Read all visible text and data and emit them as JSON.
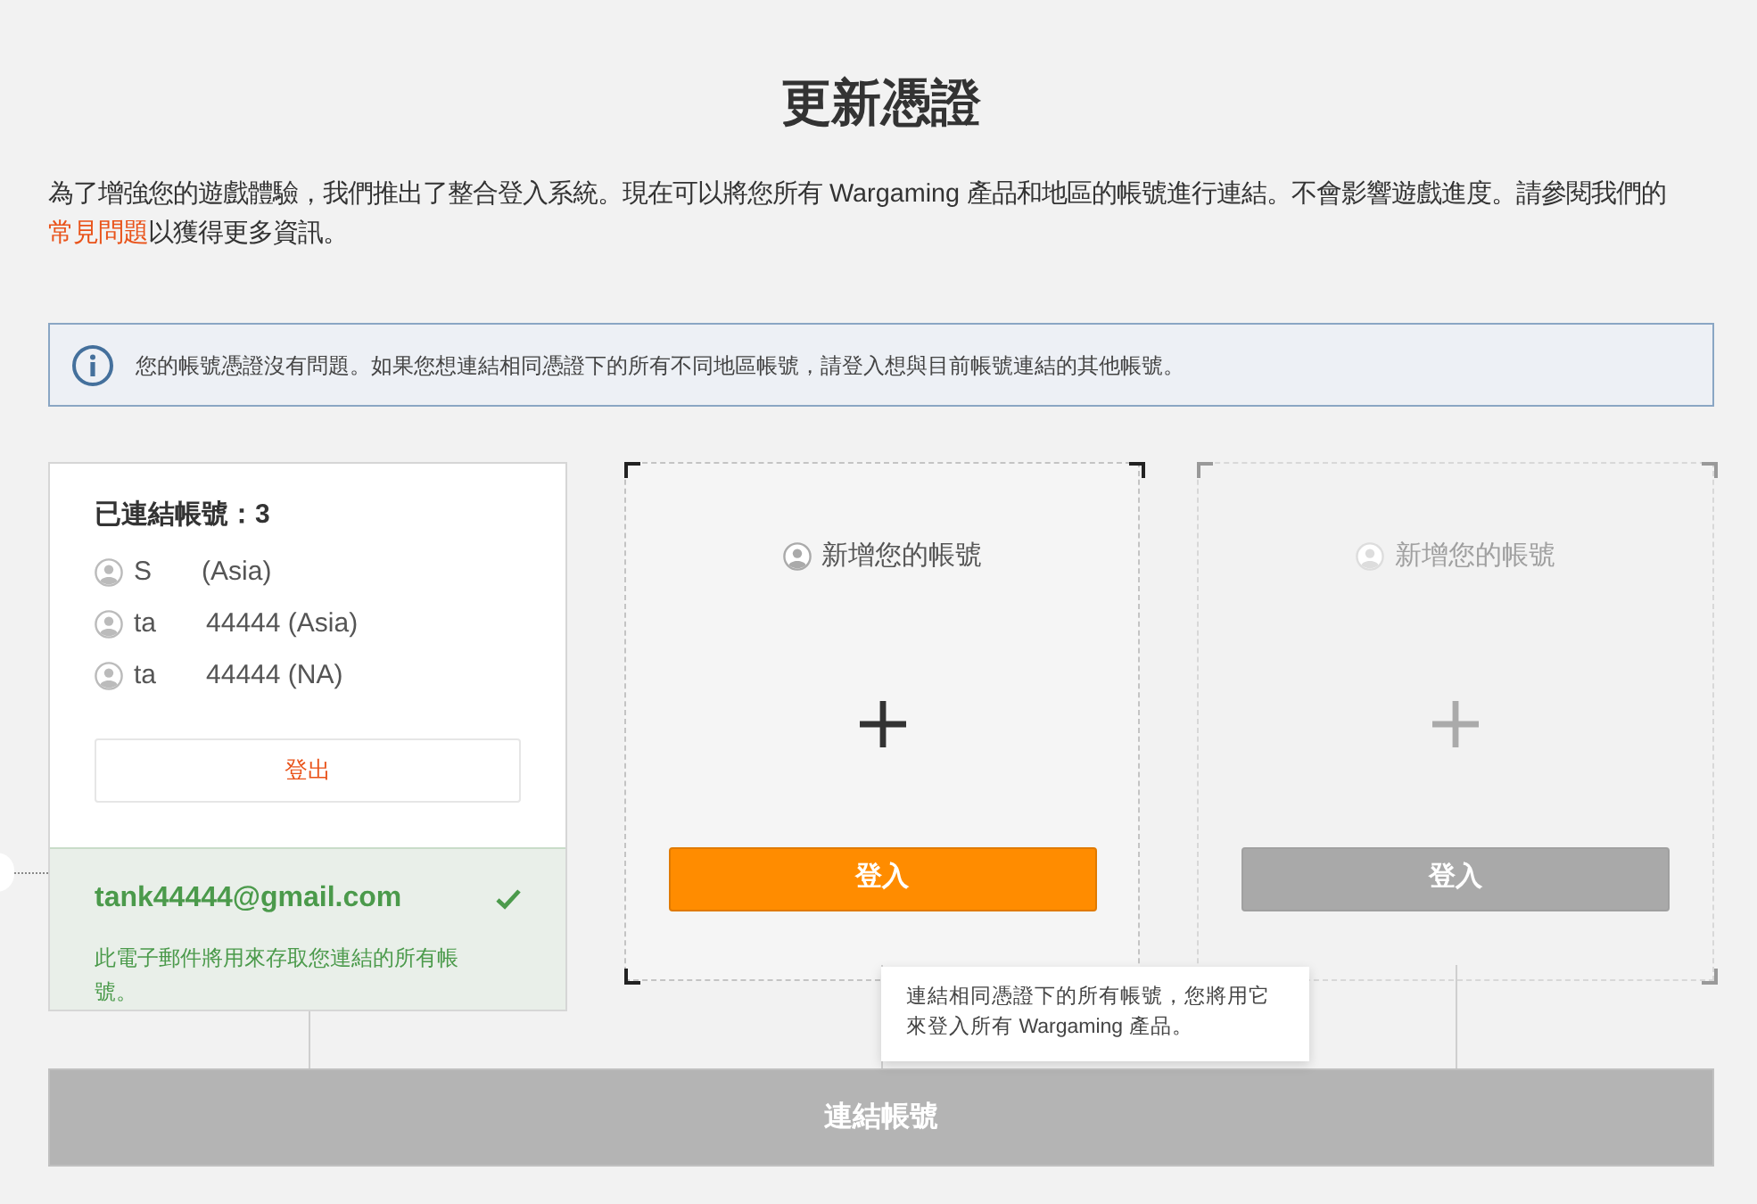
{
  "page_title": "更新憑證",
  "intro": {
    "before": "為了增強您的遊戲體驗，我們推出了整合登入系統。現在可以將您所有 Wargaming 產品和地區的帳號進行連結。不會影響遊戲進度。請參閱我們的",
    "link": "常見問題",
    "after": "以獲得更多資訊。"
  },
  "notice": "您的帳號憑證沒有問題。如果您想連結相同憑證下的所有不同地區帳號，請登入想與目前帳號連結的其他帳號。",
  "linked_accounts": {
    "heading": "已連結帳號：3",
    "accounts": [
      {
        "visible_start": "S",
        "visible_end": "(Asia)"
      },
      {
        "visible_start": "ta",
        "visible_end": "44444 (Asia)"
      },
      {
        "visible_start": "ta",
        "visible_end": "44444 (NA)"
      }
    ],
    "logout": "登出",
    "email": "tank44444@gmail.com",
    "verified": true,
    "email_note": "此電子郵件將用來存取您連結的所有帳號。"
  },
  "add_slots": [
    {
      "label": "新增您的帳號",
      "button": "登入",
      "disabled": false
    },
    {
      "label": "新增您的帳號",
      "button": "登入",
      "disabled": true
    }
  ],
  "tooltip": "連結相同憑證下的所有帳號，您將用它來登入所有 Wargaming 產品。",
  "link_button": {
    "label": "連結帳號",
    "disabled": true
  }
}
